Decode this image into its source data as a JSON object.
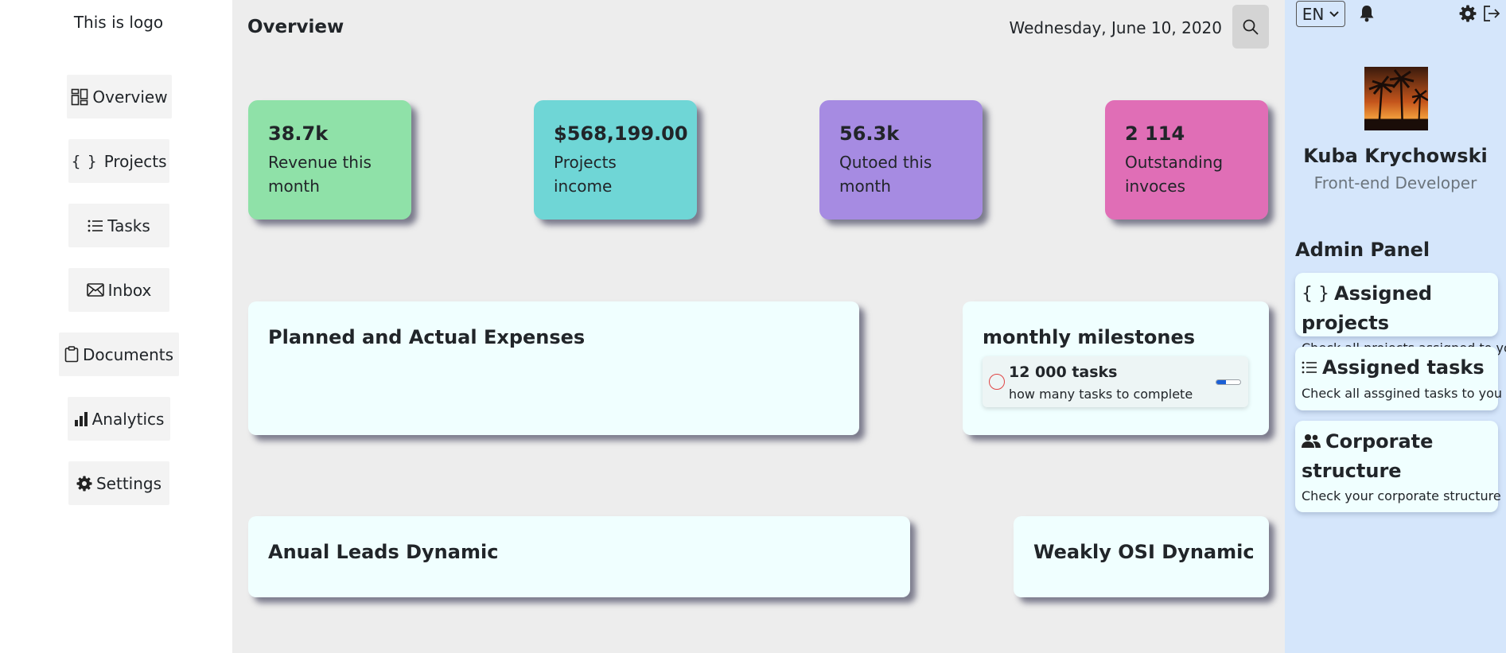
{
  "sidebar": {
    "logo": "This is logo",
    "items": [
      {
        "label": "Overview",
        "icon": "overview-grid-icon"
      },
      {
        "label": "Projects",
        "icon": "braces-icon",
        "icon_text": "{ }"
      },
      {
        "label": "Tasks",
        "icon": "list-icon"
      },
      {
        "label": "Inbox",
        "icon": "envelope-icon"
      },
      {
        "label": "Documents",
        "icon": "clipboard-icon"
      },
      {
        "label": "Analytics",
        "icon": "bar-chart-icon"
      },
      {
        "label": "Settings",
        "icon": "gear-icon"
      }
    ]
  },
  "header": {
    "title": "Overview",
    "date": "Wednesday, June 10, 2020"
  },
  "stats": [
    {
      "value": "38.7k",
      "label": "Revenue this month",
      "color": "#8fe1a8"
    },
    {
      "value": "$568,199.00",
      "label": "Projects income",
      "color": "#6fd6d6"
    },
    {
      "value": "56.3k",
      "label": "Qutoed this month",
      "color": "#a68be2"
    },
    {
      "value": "2 114",
      "label": "Outstanding invoces",
      "color": "#e06eb6"
    }
  ],
  "panels": {
    "expenses_title": "Planned and Actual Expenses",
    "milestones_title": "monthly milestones",
    "milestone": {
      "title": "12 000 tasks",
      "subtitle": "how many tasks to complete",
      "progress_fraction": 0.4
    },
    "leads_title": "Anual Leads Dynamic",
    "osi_title": "Weakly OSI Dynamic"
  },
  "right_panel": {
    "language": "EN",
    "user_name": "Kuba Krychowski",
    "user_role": "Front-end Developer",
    "admin_title": "Admin Panel",
    "admin_items": [
      {
        "title": "Assigned projects",
        "icon_text": "{ }",
        "description": "Check all projects assigned to you"
      },
      {
        "title": "Assigned tasks",
        "description": "Check all assgined tasks to you"
      },
      {
        "title": "Corporate structure",
        "description": "Check your corporate structure"
      }
    ]
  },
  "colors": {
    "sidebar_bg": "#ffffff",
    "main_bg": "#ededed",
    "right_bg": "#d5e6fb",
    "panel_bg": "#f0ffff",
    "progress_fill": "#1a5fd6"
  }
}
